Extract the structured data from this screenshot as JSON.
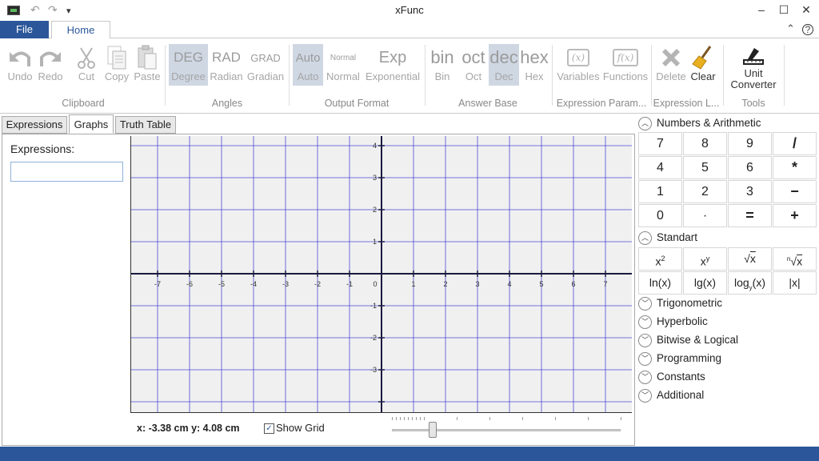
{
  "window": {
    "title": "xFunc"
  },
  "ribbon_tabs": {
    "file": "File",
    "home": "Home"
  },
  "clipboard": {
    "undo": "Undo",
    "redo": "Redo",
    "cut": "Cut",
    "copy": "Copy",
    "paste": "Paste",
    "group": "Clipboard"
  },
  "angles": {
    "deg_big": "DEG",
    "deg": "Degree",
    "rad_big": "RAD",
    "rad": "Radian",
    "grad_big": "GRAD",
    "grad": "Gradian",
    "group": "Angles"
  },
  "output_format": {
    "auto_big": "Auto",
    "auto": "Auto",
    "normal_big": "Normal",
    "normal": "Normal",
    "exp_big": "Exp",
    "exp": "Exponential",
    "group": "Output Format"
  },
  "answer_base": {
    "bin_big": "bin",
    "bin": "Bin",
    "oct_big": "oct",
    "oct": "Oct",
    "dec_big": "dec",
    "dec": "Dec",
    "hex_big": "hex",
    "hex": "Hex",
    "group": "Answer Base"
  },
  "expression_params": {
    "variables_icon": "(x)",
    "variables": "Variables",
    "functions_icon": "f(x)",
    "functions": "Functions",
    "group": "Expression Param..."
  },
  "expression_l": {
    "delete": "Delete",
    "clear": "Clear",
    "group": "Expression L..."
  },
  "tools": {
    "unit_converter_1": "Unit",
    "unit_converter_2": "Converter",
    "group": "Tools"
  },
  "panel_tabs": {
    "expressions": "Expressions",
    "graphs": "Graphs",
    "truth_table": "Truth Table"
  },
  "graph_panel": {
    "expressions_label": "Expressions:",
    "expression_value": "",
    "coord_readout": "x: -3.38 cm y: 4.08 cm",
    "show_grid_label": "Show Grid",
    "show_grid_checked": true,
    "zoom_fraction": 0.18,
    "x_ticks": [
      "-7",
      "-6",
      "-5",
      "-4",
      "-3",
      "-2",
      "-1",
      "0",
      "1",
      "2",
      "3",
      "4",
      "5",
      "6",
      "7"
    ],
    "y_ticks": [
      "4",
      "3",
      "2",
      "1",
      "-1",
      "-2",
      "-3"
    ],
    "grid_color": "#4a4ad8",
    "axis_color": "#1a1a40"
  },
  "keypad": {
    "numbers_section": "Numbers & Arithmetic",
    "number_keys": [
      "7",
      "8",
      "9",
      "/",
      "4",
      "5",
      "6",
      "*",
      "1",
      "2",
      "3",
      "−",
      "0",
      "·",
      "=",
      "+"
    ],
    "standart_section": "Standart",
    "collapsed_sections": [
      "Trigonometric",
      "Hyperbolic",
      "Bitwise & Logical",
      "Programming",
      "Constants",
      "Additional"
    ]
  },
  "colors": {
    "accent": "#2b579a",
    "selected": "#cfd7e3"
  }
}
